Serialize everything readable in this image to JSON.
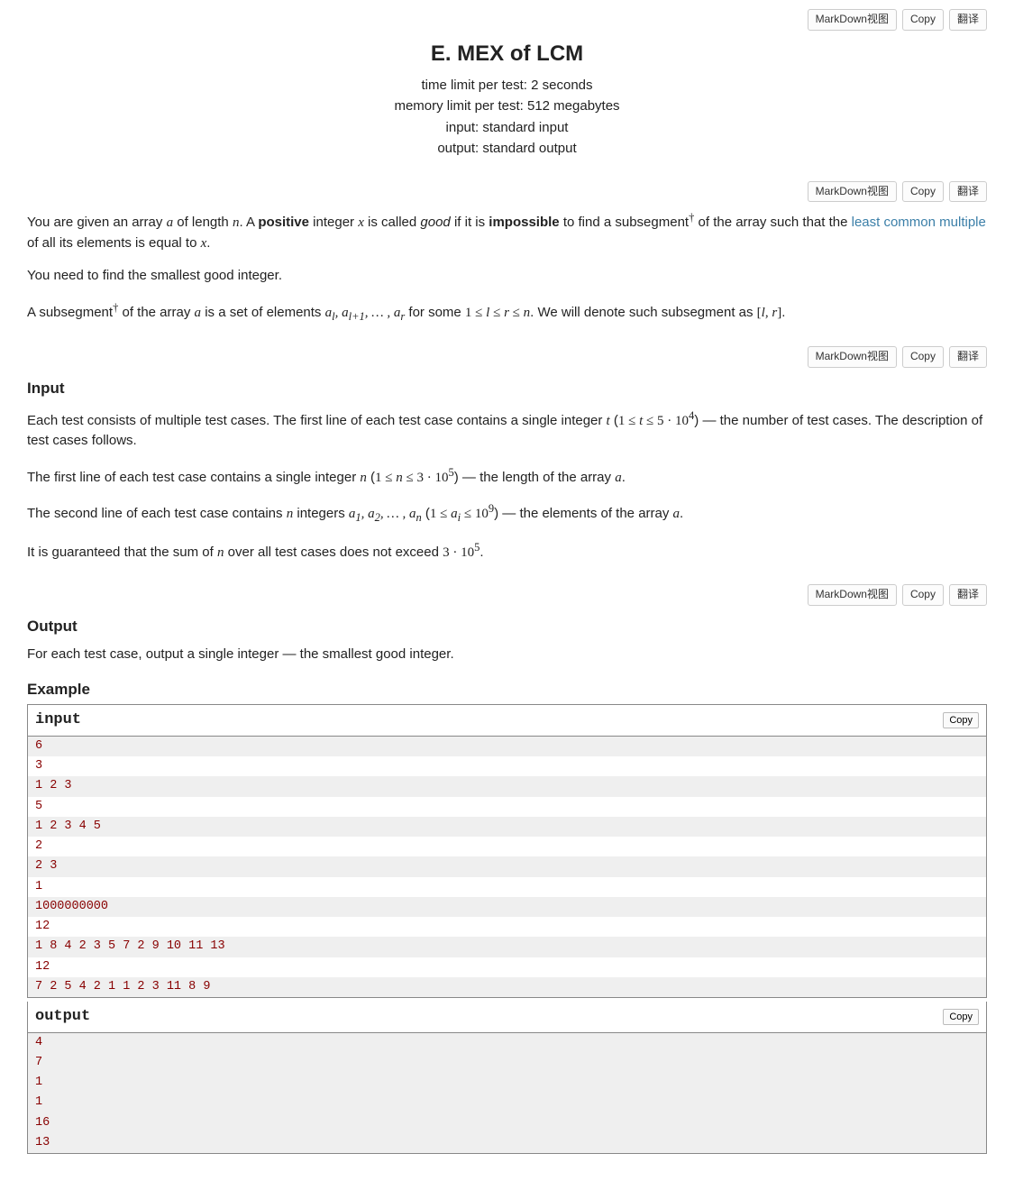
{
  "buttons": {
    "markdown": "MarkDown视图",
    "copy": "Copy",
    "translate": "翻译"
  },
  "header": {
    "title": "E. MEX of LCM",
    "time_limit": "time limit per test: 2 seconds",
    "memory_limit": "memory limit per test: 512 megabytes",
    "input_spec": "input: standard input",
    "output_spec": "output: standard output"
  },
  "statement": {
    "p1_pre": "You are given an array ",
    "p1_a": "a",
    "p1_mid1": " of length ",
    "p1_n": "n",
    "p1_mid2": ". A ",
    "p1_positive": "positive",
    "p1_mid3": " integer ",
    "p1_x": "x",
    "p1_mid4": " is called ",
    "p1_good": "good",
    "p1_mid5": " if it is ",
    "p1_impossible": "impossible",
    "p1_mid6": " to find a subsegment",
    "p1_dag": "†",
    "p1_mid7": " of the array such that the ",
    "p1_lcm_link": "least common multiple",
    "p1_mid8": " of all its elements is equal to ",
    "p1_x2": "x",
    "p1_end": ".",
    "p2": "You need to find the smallest good integer.",
    "p3_pre": "A subsegment",
    "p3_dag": "†",
    "p3_mid1": " of the array ",
    "p3_a": "a",
    "p3_mid2": " is a set of elements ",
    "p3_seq": "a_l, a_{l+1}, … , a_r",
    "p3_mid3": " for some ",
    "p3_cond": "1 ≤ l ≤ r ≤ n",
    "p3_mid4": ". We will denote such subsegment as ",
    "p3_lr": "[l, r]",
    "p3_end": "."
  },
  "input": {
    "heading": "Input",
    "p1_pre": "Each test consists of multiple test cases. The first line of each test case contains a single integer ",
    "p1_t": "t",
    "p1_open": " (",
    "p1_cond": "1 ≤ t ≤ 5 · 10⁴",
    "p1_close": ") — the number of test cases. The description of test cases follows.",
    "p2_pre": "The first line of each test case contains a single integer ",
    "p2_n": "n",
    "p2_open": " (",
    "p2_cond": "1 ≤ n ≤ 3 · 10⁵",
    "p2_close": ") — the length of the array ",
    "p2_a": "a",
    "p2_end": ".",
    "p3_pre": "The second line of each test case contains ",
    "p3_n": "n",
    "p3_mid1": " integers ",
    "p3_seq": "a₁, a₂, … , a_n",
    "p3_open": " (",
    "p3_cond": "1 ≤ a_i ≤ 10⁹",
    "p3_close": ") — the elements of the array ",
    "p3_a": "a",
    "p3_end": ".",
    "p4_pre": "It is guaranteed that the sum of ",
    "p4_n": "n",
    "p4_mid": " over all test cases does not exceed ",
    "p4_val": "3 · 10⁵",
    "p4_end": "."
  },
  "output": {
    "heading": "Output",
    "p1": "For each test case, output a single integer — the smallest good integer."
  },
  "example": {
    "heading": "Example",
    "input_label": "input",
    "output_label": "output",
    "copy_label": "Copy",
    "input_lines": [
      "6",
      "3",
      "1 2 3",
      "5",
      "1 2 3 4 5",
      "2",
      "2 3",
      "1",
      "1000000000",
      "12",
      "1 8 4 2 3 5 7 2 9 10 11 13",
      "12",
      "7 2 5 4 2 1 1 2 3 11 8 9"
    ],
    "output_lines": [
      "4",
      "7",
      "1",
      "1",
      "16",
      "13"
    ]
  }
}
